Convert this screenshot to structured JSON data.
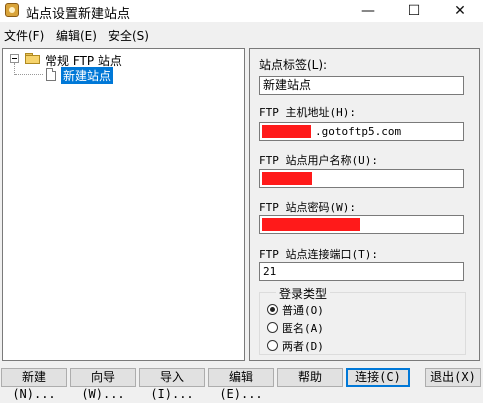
{
  "window": {
    "title": "站点设置新建站点",
    "minimize_glyph": "—",
    "maximize_glyph": "☐",
    "close_glyph": "✕",
    "icon": "app-icon"
  },
  "menu": {
    "file": "文件(F)",
    "edit": "编辑(E)",
    "security": "安全(S)"
  },
  "tree": {
    "root_label": "常规 FTP 站点",
    "root_icon": "folder-icon",
    "child_label": "新建站点",
    "child_icon": "document-icon",
    "selection_color": "#0078d7"
  },
  "form": {
    "site_label_caption": "站点标签(L):",
    "site_label_value": "新建站点",
    "host_caption": "FTP 主机地址(H):",
    "host_value_visible": ".gotoftp5.com",
    "user_caption": "FTP 站点用户名称(U):",
    "password_caption": "FTP 站点密码(W):",
    "port_caption": "FTP 站点连接端口(T):",
    "port_value": "21",
    "redaction_color": "#ff1a1a"
  },
  "login_type": {
    "title": "登录类型",
    "options": [
      {
        "label": "普通(O)",
        "selected": true
      },
      {
        "label": "匿名(A)",
        "selected": false
      },
      {
        "label": "两者(D)",
        "selected": false
      }
    ]
  },
  "buttons": {
    "new": "新建(N)...",
    "wizard": "向导(W)...",
    "import": "导入(I)...",
    "edit": "编辑(E)...",
    "help": "帮助",
    "connect": "连接(C)",
    "exit": "退出(X)"
  }
}
